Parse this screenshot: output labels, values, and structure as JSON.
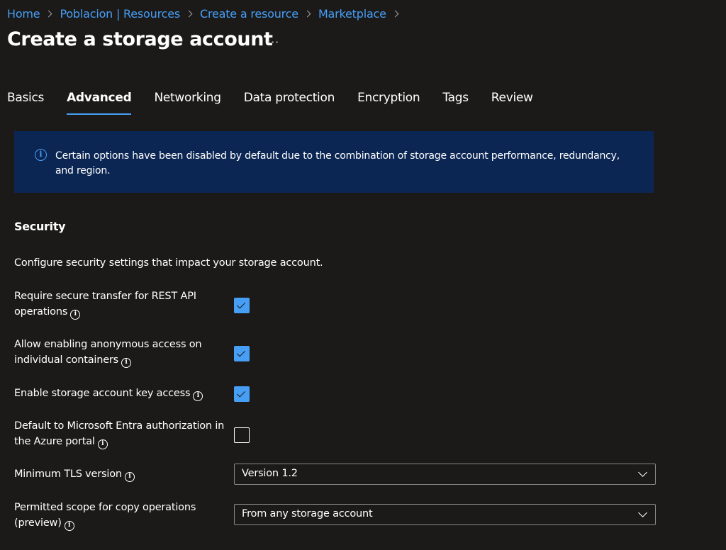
{
  "breadcrumb": [
    "Home",
    "Poblacion | Resources",
    "Create a resource",
    "Marketplace"
  ],
  "title": "Create a storage account",
  "more_label": "···",
  "tabs": [
    {
      "label": "Basics",
      "active": false
    },
    {
      "label": "Advanced",
      "active": true
    },
    {
      "label": "Networking",
      "active": false
    },
    {
      "label": "Data protection",
      "active": false
    },
    {
      "label": "Encryption",
      "active": false
    },
    {
      "label": "Tags",
      "active": false
    },
    {
      "label": "Review",
      "active": false
    }
  ],
  "banner": {
    "icon": "i",
    "text": "Certain options have been disabled by default due to the combination of storage account performance, redundancy, and region."
  },
  "security": {
    "title": "Security",
    "description": "Configure security settings that impact your storage account.",
    "options": [
      {
        "label": "Require secure transfer for REST API operations",
        "checked": true
      },
      {
        "label": "Allow enabling anonymous access on individual containers",
        "checked": true
      },
      {
        "label": "Enable storage account key access",
        "checked": true
      },
      {
        "label": "Default to Microsoft Entra authorization in the Azure portal",
        "checked": false
      }
    ],
    "tls": {
      "label": "Minimum TLS version",
      "value": "Version 1.2"
    },
    "copy_scope": {
      "label": "Permitted scope for copy operations (preview)",
      "value": "From any storage account"
    }
  },
  "info_glyph": "i",
  "colors": {
    "background": "#1b1a19",
    "accent": "#479ef5",
    "banner": "#0c2654"
  }
}
